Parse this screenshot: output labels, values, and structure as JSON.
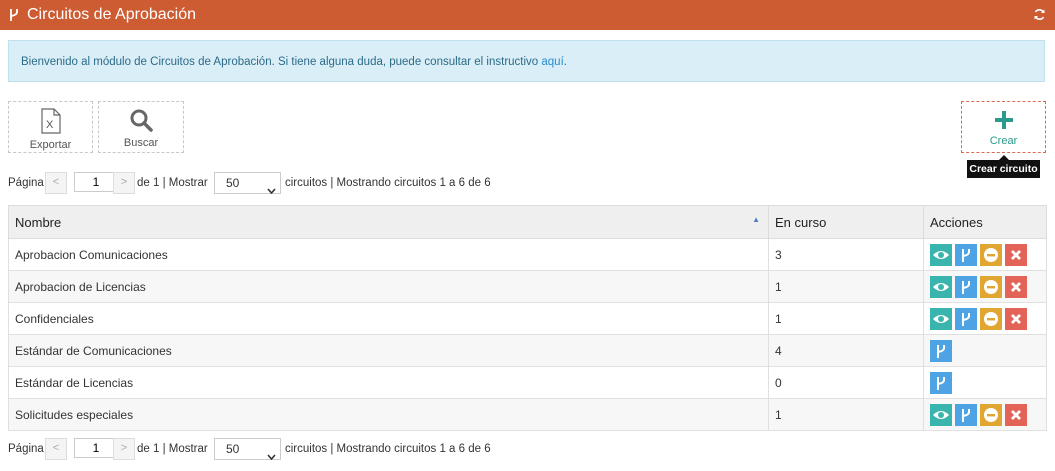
{
  "header": {
    "title": "Circuitos de Aprobación"
  },
  "info": {
    "text": "Bienvenido al módulo de Circuitos de Aprobación. Si tiene alguna duda, puede consultar el instructivo ",
    "link": "aquí",
    "end": "."
  },
  "toolbar": {
    "export_label": "Exportar",
    "search_label": "Buscar",
    "create_label": "Crear",
    "create_tooltip": "Crear circuito"
  },
  "pager": {
    "page_label": "Página",
    "prev": "<",
    "page_value": "1",
    "next": ">",
    "of_text": "de 1 | Mostrar",
    "per_page": "50",
    "summary": "circuitos | Mostrando circuitos 1 a 6 de 6"
  },
  "table": {
    "headers": {
      "name": "Nombre",
      "in_progress": "En curso",
      "actions": "Acciones"
    },
    "rows": [
      {
        "name": "Aprobacion Comunicaciones",
        "count": "3"
      },
      {
        "name": "Aprobacion de Licencias",
        "count": "1"
      },
      {
        "name": "Confidenciales",
        "count": "1"
      },
      {
        "name": "Estándar de Comunicaciones",
        "count": "4"
      },
      {
        "name": "Estándar de Licencias",
        "count": "0"
      },
      {
        "name": "Solicitudes especiales",
        "count": "1"
      }
    ]
  },
  "colors": {
    "header": "#cd5c33",
    "view": "#39b5ad",
    "branch": "#4da3e3",
    "disable": "#e1a532",
    "delete": "#e36358",
    "create_plus": "#2a9a8c"
  },
  "icons": [
    "branch-icon",
    "refresh-icon",
    "excel-icon",
    "search-icon",
    "plus-icon",
    "eye-icon",
    "minus-icon",
    "close-icon"
  ]
}
